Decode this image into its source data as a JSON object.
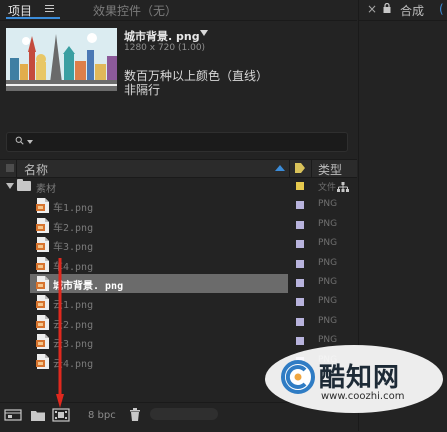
{
  "project_panel": {
    "tab_project": "项目",
    "tab_effects": "效果控件（无）",
    "footage_info": {
      "name": "城市背景. png",
      "dimensions": "1280 x 720 (1.00)",
      "colors": "数百万种以上颜色（直线）",
      "interlace": "非隔行"
    },
    "columns": {
      "name": "名称",
      "type": "类型"
    },
    "items": [
      {
        "kind": "folder",
        "name": "素材",
        "type": "文件",
        "label_color": "#e6c94e",
        "selected": false
      },
      {
        "kind": "file",
        "name": "车1.png",
        "type": "PNG",
        "label_color": "#b8b3dd",
        "selected": false
      },
      {
        "kind": "file",
        "name": "车2.png",
        "type": "PNG",
        "label_color": "#b8b3dd",
        "selected": false
      },
      {
        "kind": "file",
        "name": "车3.png",
        "type": "PNG",
        "label_color": "#b8b3dd",
        "selected": false
      },
      {
        "kind": "file",
        "name": "车4.png",
        "type": "PNG",
        "label_color": "#b8b3dd",
        "selected": false
      },
      {
        "kind": "file",
        "name": "城市背景. png",
        "type": "PNG",
        "label_color": "#b8b3dd",
        "selected": true
      },
      {
        "kind": "file",
        "name": "云1.png",
        "type": "PNG",
        "label_color": "#b8b3dd",
        "selected": false
      },
      {
        "kind": "file",
        "name": "云2.png",
        "type": "PNG",
        "label_color": "#b8b3dd",
        "selected": false
      },
      {
        "kind": "file",
        "name": "云3.png",
        "type": "PNG",
        "label_color": "#b8b3dd",
        "selected": false
      },
      {
        "kind": "file",
        "name": "云4.png",
        "type": "PNG",
        "label_color": "#b8b3dd",
        "selected": false
      }
    ],
    "bottom": {
      "bpc": "8 bpc"
    }
  },
  "comp_panel": {
    "tab_label": "合成"
  },
  "watermark": {
    "title": "酷知网",
    "url": "www.coozhi.com"
  },
  "colors": {
    "accent": "#3b8cd9",
    "selection": "#6b6b6b",
    "annotation_arrow": "#e0281e"
  }
}
